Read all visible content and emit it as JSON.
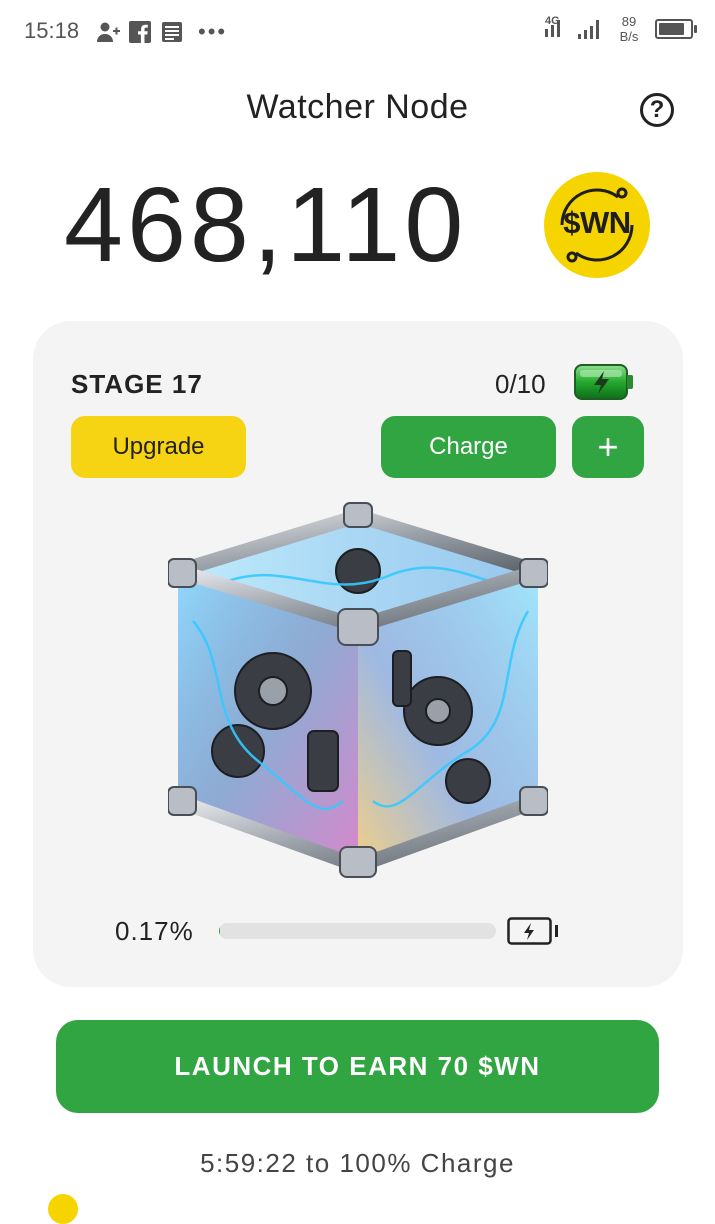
{
  "status_bar": {
    "time": "15:18",
    "notification_icons": [
      "add-contact-icon",
      "facebook-icon",
      "news-icon"
    ],
    "more": "•••",
    "network_label": "4G",
    "speed_value": "89",
    "speed_unit": "B/s",
    "battery_level": 0.85
  },
  "header": {
    "title": "Watcher Node",
    "help_label": "?"
  },
  "balance": {
    "amount": "468,110",
    "token": "$WN",
    "token_color": "#f5d400"
  },
  "card": {
    "stage_label": "STAGE 17",
    "charges": "0/10",
    "upgrade_label": "Upgrade",
    "charge_label": "Charge",
    "plus_label": "+",
    "progress_text": "0.17%",
    "progress_value": 0.0017
  },
  "launch": {
    "label": "LAUNCH TO EARN 70 $WN"
  },
  "timer": {
    "text": "5:59:22 to 100% Charge"
  },
  "colors": {
    "green": "#32a543",
    "yellow": "#f7d413",
    "card_bg": "#f4f4f4"
  }
}
